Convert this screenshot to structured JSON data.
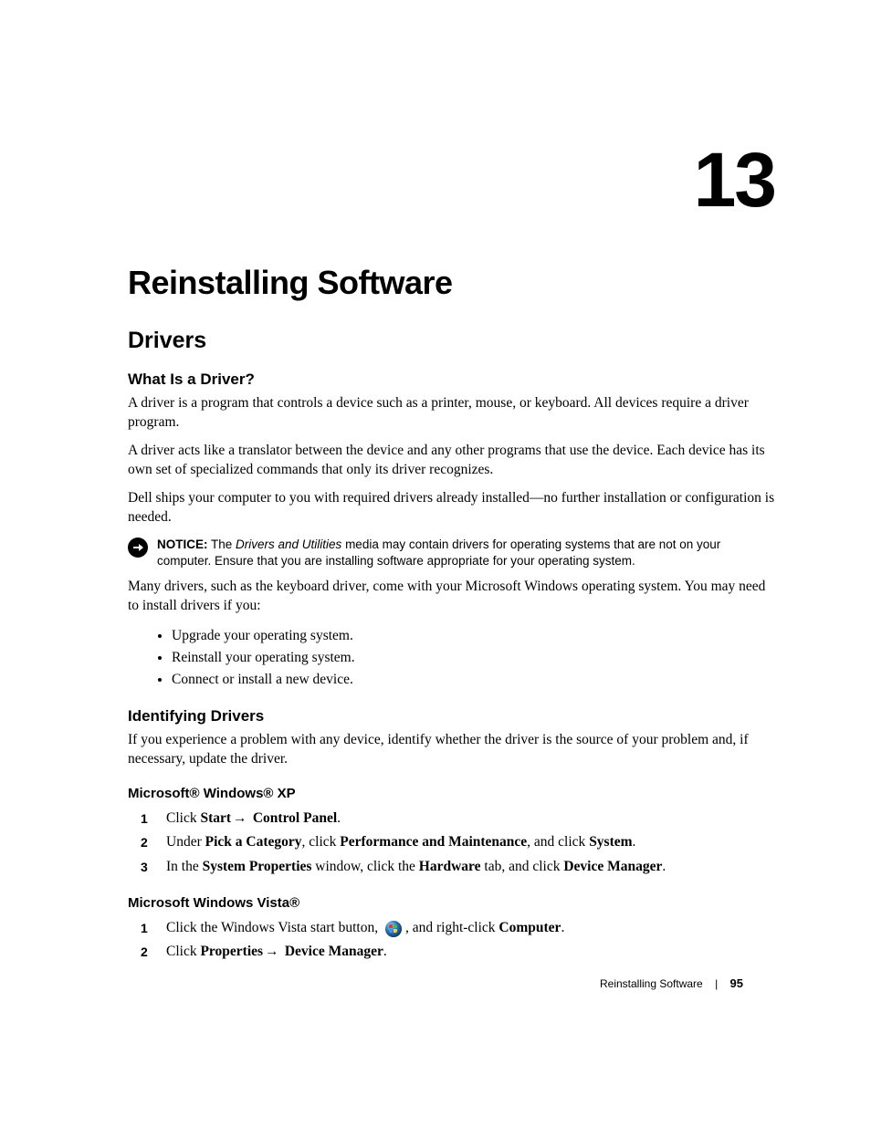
{
  "chapter": {
    "number": "13",
    "title": "Reinstalling Software"
  },
  "section_drivers": {
    "heading": "Drivers",
    "what_is": {
      "heading": "What Is a Driver?",
      "p1": "A driver is a program that controls a device such as a printer, mouse, or keyboard. All devices require a driver program.",
      "p2": "A driver acts like a translator between the device and any other programs that use the device. Each device has its own set of specialized commands that only its driver recognizes.",
      "p3": "Dell ships your computer to you with required drivers already installed—no further installation or configuration is needed."
    },
    "notice": {
      "label": "NOTICE:",
      "pre": " The ",
      "italic": "Drivers and Utilities",
      "post": " media may contain drivers for operating systems that are not on your computer. Ensure that you are installing software appropriate for your operating system."
    },
    "many_drivers": "Many drivers, such as the keyboard driver, come with your Microsoft Windows operating system. You may need to install drivers if you:",
    "bullets": [
      "Upgrade your operating system.",
      "Reinstall your operating system.",
      "Connect or install a new device."
    ],
    "identifying": {
      "heading": "Identifying Drivers",
      "p1": "If you experience a problem with any device, identify whether the driver is the source of your problem and, if necessary, update the driver."
    },
    "xp": {
      "heading": "Microsoft® Windows® XP",
      "steps": {
        "s1": {
          "pre": "Click ",
          "b1": "Start",
          "arrow": "→ ",
          "b2": "Control Panel",
          "post": "."
        },
        "s2": {
          "pre": "Under ",
          "b1": "Pick a Category",
          "mid1": ", click ",
          "b2": "Performance and Maintenance",
          "mid2": ", and click ",
          "b3": "System",
          "post": "."
        },
        "s3": {
          "pre": "In the ",
          "b1": "System Properties",
          "mid1": " window, click the ",
          "b2": "Hardware",
          "mid2": " tab, and click ",
          "b3": "Device Manager",
          "post": "."
        }
      }
    },
    "vista": {
      "heading": "Microsoft Windows Vista®",
      "steps": {
        "s1": {
          "pre": "Click the Windows Vista start button, ",
          "post": ", and right-click ",
          "b1": "Computer",
          "end": "."
        },
        "s2": {
          "pre": "Click ",
          "b1": "Properties",
          "arrow": "→ ",
          "b2": "Device Manager",
          "post": "."
        }
      }
    }
  },
  "footer": {
    "title": "Reinstalling Software",
    "page": "95"
  }
}
